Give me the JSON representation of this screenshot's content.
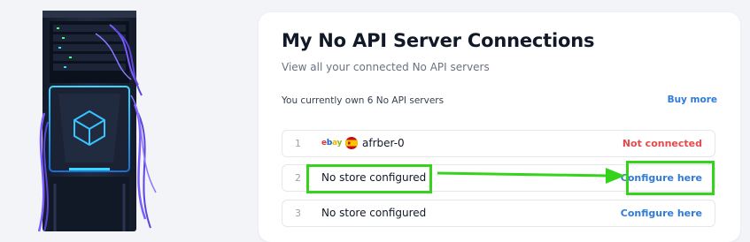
{
  "page": {
    "title": "My No API Server Connections",
    "subtitle": "View all your connected No API servers",
    "server_count_text": "You currently own 6 No API servers",
    "buy_more_label": "Buy more"
  },
  "rows": [
    {
      "index": "1",
      "marketplace": "ebay",
      "country_flag": "spain-flag-icon",
      "store_name": "afrber-0",
      "status": "Not connected"
    },
    {
      "index": "2",
      "store_name": "No store configured",
      "action": "Configure here"
    },
    {
      "index": "3",
      "store_name": "No store configured",
      "action": "Configure here"
    }
  ],
  "annotation": {
    "highlight_color": "#35d31c"
  },
  "colors": {
    "link": "#2f7bd8",
    "error": "#e5484d",
    "background": "#f2f4f8"
  }
}
